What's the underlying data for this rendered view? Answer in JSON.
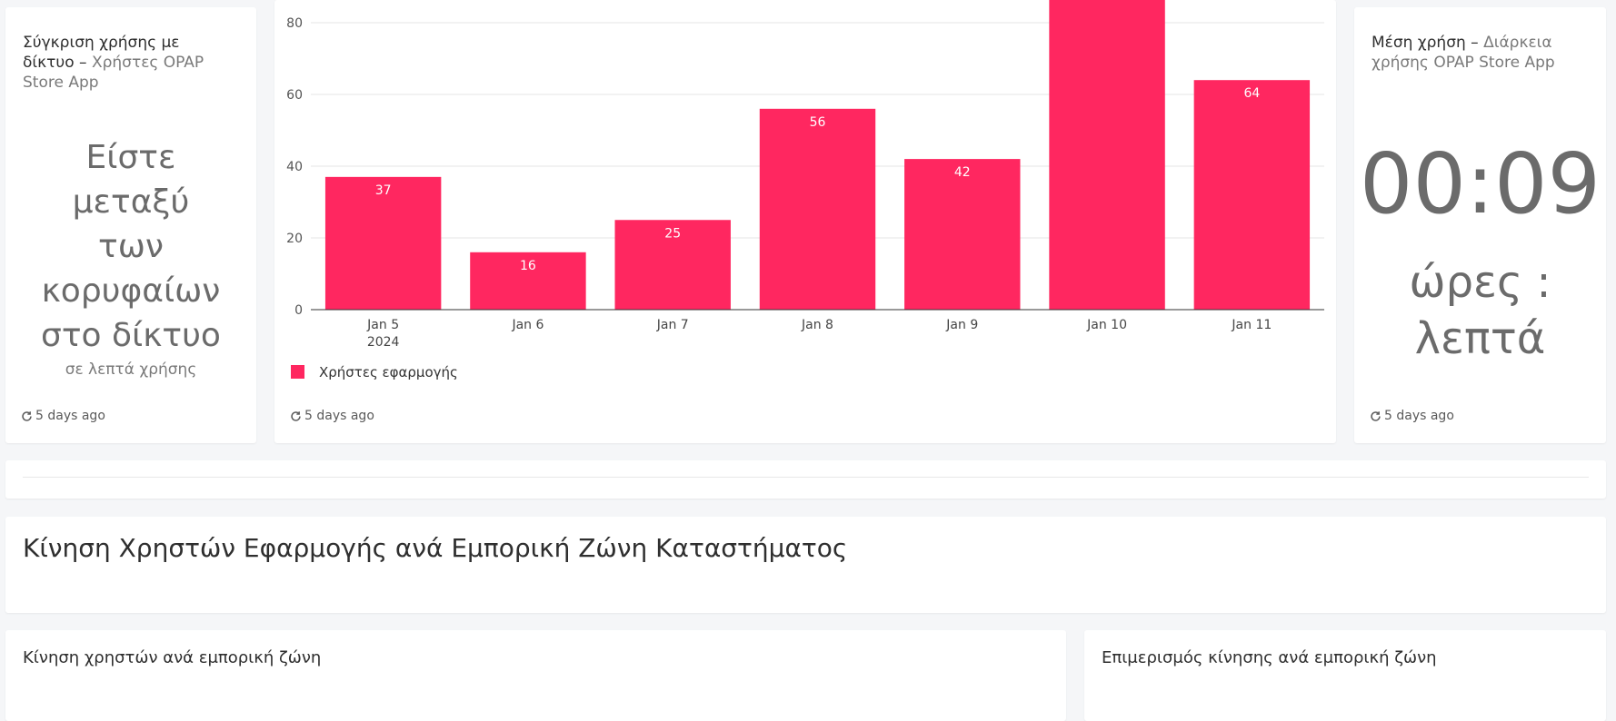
{
  "colors": {
    "bar": "#ff2760",
    "background": "#f5f6f8",
    "card": "#ffffff",
    "grid": "#e6e6e6"
  },
  "left_card": {
    "title_main": "Σύγκριση χρήσης με δίκτυο",
    "title_sep": " – ",
    "title_sub": "Χρήστες OPAP Store App",
    "big_line1": "Είστε",
    "big_line2": "μεταξύ",
    "big_line3": "των",
    "big_line4": "κορυφαίων",
    "big_line5": "στο δίκτυο",
    "small_text": "σε λεπτά χρήσης",
    "refresh_icon": "refresh-icon",
    "updated": "5 days ago"
  },
  "chart_card": {
    "refresh_icon": "refresh-icon",
    "updated": "5 days ago"
  },
  "chart_data": {
    "type": "bar",
    "categories": [
      "Jan 5",
      "Jan 6",
      "Jan 7",
      "Jan 8",
      "Jan 9",
      "Jan 10",
      "Jan 11"
    ],
    "first_category_sublabel": "2024",
    "series": [
      {
        "name": "Χρήστες εφαρμογής",
        "values": [
          37,
          16,
          25,
          56,
          42,
          90,
          64
        ],
        "labels": [
          "37",
          "16",
          "25",
          "56",
          "42",
          "",
          "64"
        ]
      }
    ],
    "y_ticks": [
      0,
      20,
      40,
      60,
      80
    ],
    "ylim": [
      0,
      88
    ],
    "grid": true,
    "legend_position": "bottom-left"
  },
  "right_card": {
    "title_main": "Μέση χρήση",
    "title_sep": " – ",
    "title_sub": "Διάρκεια χρήσης OPAP Store App",
    "value": "00:09",
    "unit_line1": "ώρες :",
    "unit_line2": "λεπτά",
    "refresh_icon": "refresh-icon",
    "updated": "5 days ago"
  },
  "section": {
    "heading": "Κίνηση Χρηστών Εφαρμογής ανά Εμπορική Ζώνη Καταστήματος"
  },
  "bottom_left": {
    "title": "Κίνηση χρηστών ανά εμπορική ζώνη"
  },
  "bottom_right": {
    "title": "Επιμερισμός κίνησης ανά εμπορική ζώνη"
  }
}
